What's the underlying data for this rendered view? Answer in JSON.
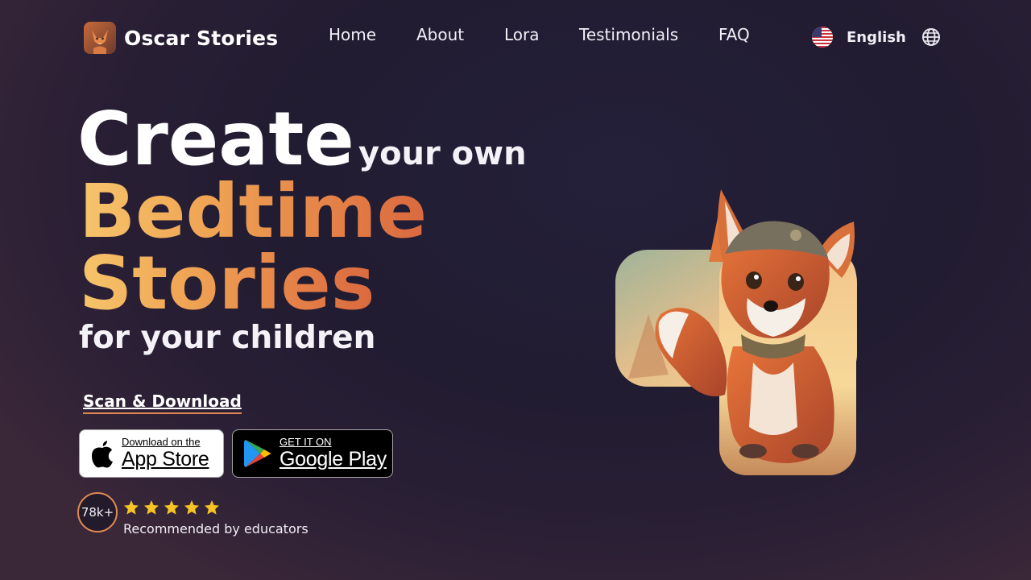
{
  "brand": {
    "name": "Oscar Stories",
    "logo_icon": "fox-logo-icon"
  },
  "nav": {
    "items": [
      {
        "label": "Home"
      },
      {
        "label": "About"
      },
      {
        "label": "Lora"
      },
      {
        "label": "Testimonials"
      },
      {
        "label": "FAQ"
      }
    ]
  },
  "language": {
    "label": "English",
    "flag_icon": "us-flag-icon",
    "globe_icon": "globe-icon"
  },
  "hero": {
    "line1_big": "Create",
    "line1_small": "your own",
    "line2": "Bedtime",
    "line3": "Stories",
    "line4": "for your children"
  },
  "download": {
    "scan_label": "Scan & Download",
    "app_store": {
      "small": "Download on the",
      "big": "App Store"
    },
    "google_play": {
      "small": "GET IT ON",
      "big": "Google Play"
    }
  },
  "social_proof": {
    "count": "78k+",
    "stars": 5,
    "text": "Recommended by educators"
  },
  "colors": {
    "accent_start": "#f6c56b",
    "accent_end": "#d9693f",
    "star": "#f7c325",
    "bg": "#221d33"
  }
}
